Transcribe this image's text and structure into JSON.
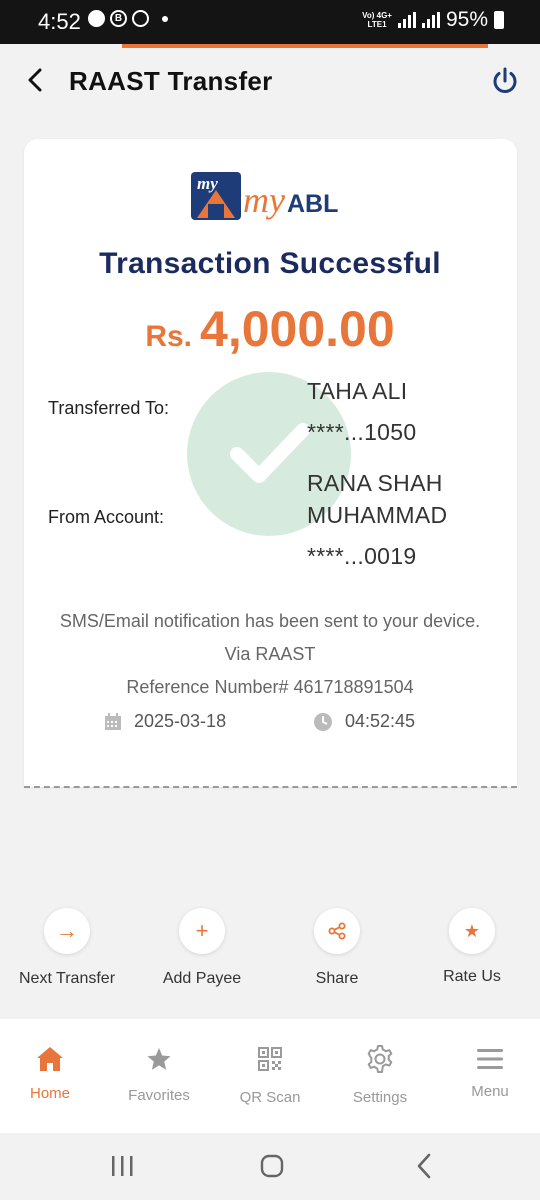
{
  "status_bar": {
    "time": "4:52",
    "network": "Vo) 4G+ LTE1",
    "battery": "95%"
  },
  "header": {
    "title": "RAAST Transfer"
  },
  "logo": {
    "box_text": "my",
    "text_my": "my",
    "text_abl": "ABL"
  },
  "receipt": {
    "status": "Transaction Successful",
    "currency": "Rs.",
    "amount": "4,000.00",
    "transferred_to_label": "Transferred To:",
    "transferred_to_name": "TAHA ALI",
    "transferred_to_account": "****...1050",
    "from_account_label": "From Account:",
    "from_account_name_line1": "RANA SHAH",
    "from_account_name_line2": "MUHAMMAD",
    "from_account_number": "****...0019",
    "notification": "SMS/Email notification has been sent to your device.",
    "via": "Via RAAST",
    "reference": "Reference Number# 461718891504",
    "date": "2025-03-18",
    "time": "04:52:45"
  },
  "actions": [
    {
      "label": "Next Transfer",
      "icon": "arrow-right-icon",
      "glyph": "→"
    },
    {
      "label": "Add Payee",
      "icon": "plus-icon",
      "glyph": "+"
    },
    {
      "label": "Share",
      "icon": "share-icon",
      "glyph": ""
    },
    {
      "label": "Rate Us",
      "icon": "star-icon",
      "glyph": "★"
    }
  ],
  "bottom_nav": [
    {
      "label": "Home",
      "icon": "home-icon",
      "active": true
    },
    {
      "label": "Favorites",
      "icon": "star-icon"
    },
    {
      "label": "QR Scan",
      "icon": "qr-code-icon"
    },
    {
      "label": "Settings",
      "icon": "gear-icon"
    },
    {
      "label": "Menu",
      "icon": "hamburger-menu-icon"
    }
  ],
  "colors": {
    "accent": "#e8763a",
    "navy": "#1c2b5e",
    "success_circle": "#d6ebde"
  }
}
